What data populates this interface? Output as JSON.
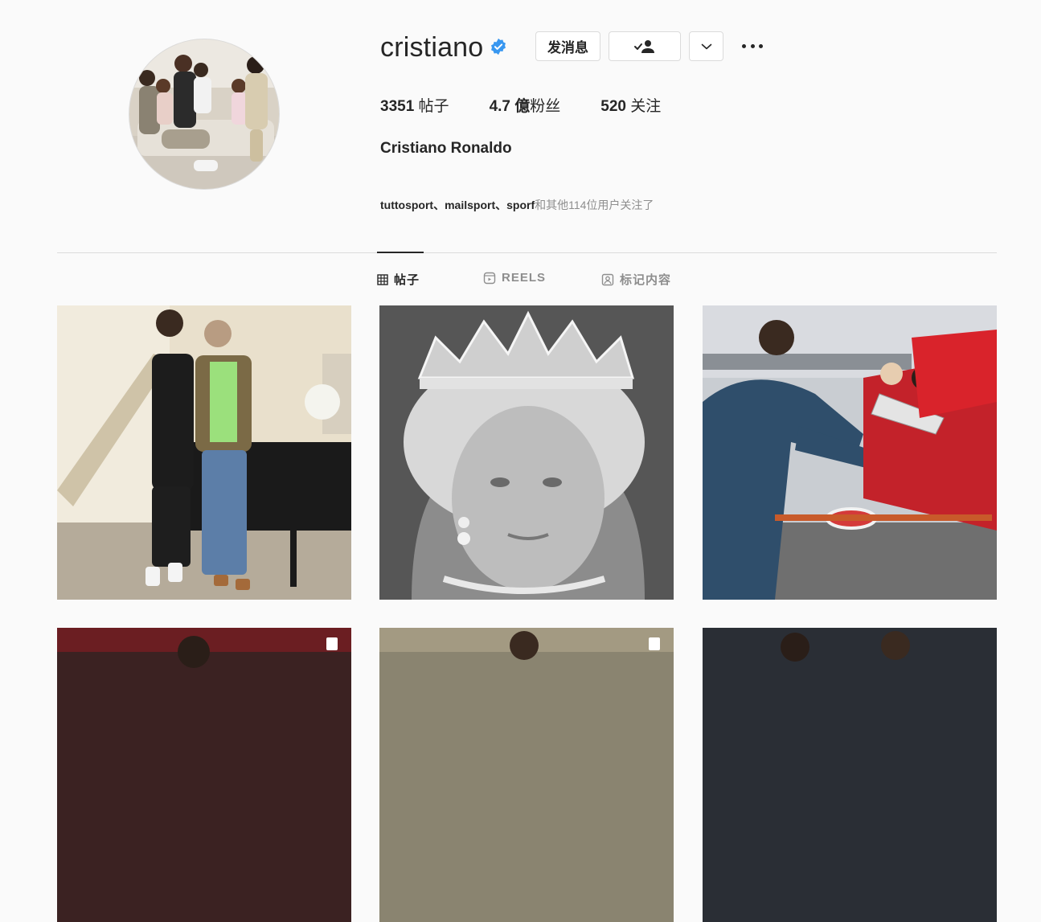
{
  "profile": {
    "username": "cristiano",
    "full_name": "Cristiano Ronaldo",
    "verified_icon": "verified-badge-icon"
  },
  "actions": {
    "message_label": "发消息",
    "follow_icon": "person-check-icon",
    "more_icon": "chevron-down-icon",
    "options_icon": "more-horizontal-icon"
  },
  "stats": {
    "posts_value": "3351",
    "posts_label": " 帖子",
    "followers_value": "4.7 億",
    "followers_label": "粉丝",
    "following_value": "520",
    "following_label": " 关注"
  },
  "followed_by": {
    "names": "tuttosport、mailsport、sporf",
    "suffix": "和其他114位用户关注了"
  },
  "tabs": [
    {
      "label": "帖子",
      "icon": "grid-icon",
      "active": true
    },
    {
      "label": "REELS",
      "icon": "reels-icon",
      "active": false
    },
    {
      "label": "标记内容",
      "icon": "tagged-icon",
      "active": false
    }
  ],
  "colors": {
    "background": "#fafafa",
    "verified": "#3897f0",
    "text": "#262626",
    "muted": "#8e8e8e",
    "border": "#dbdbdb"
  }
}
